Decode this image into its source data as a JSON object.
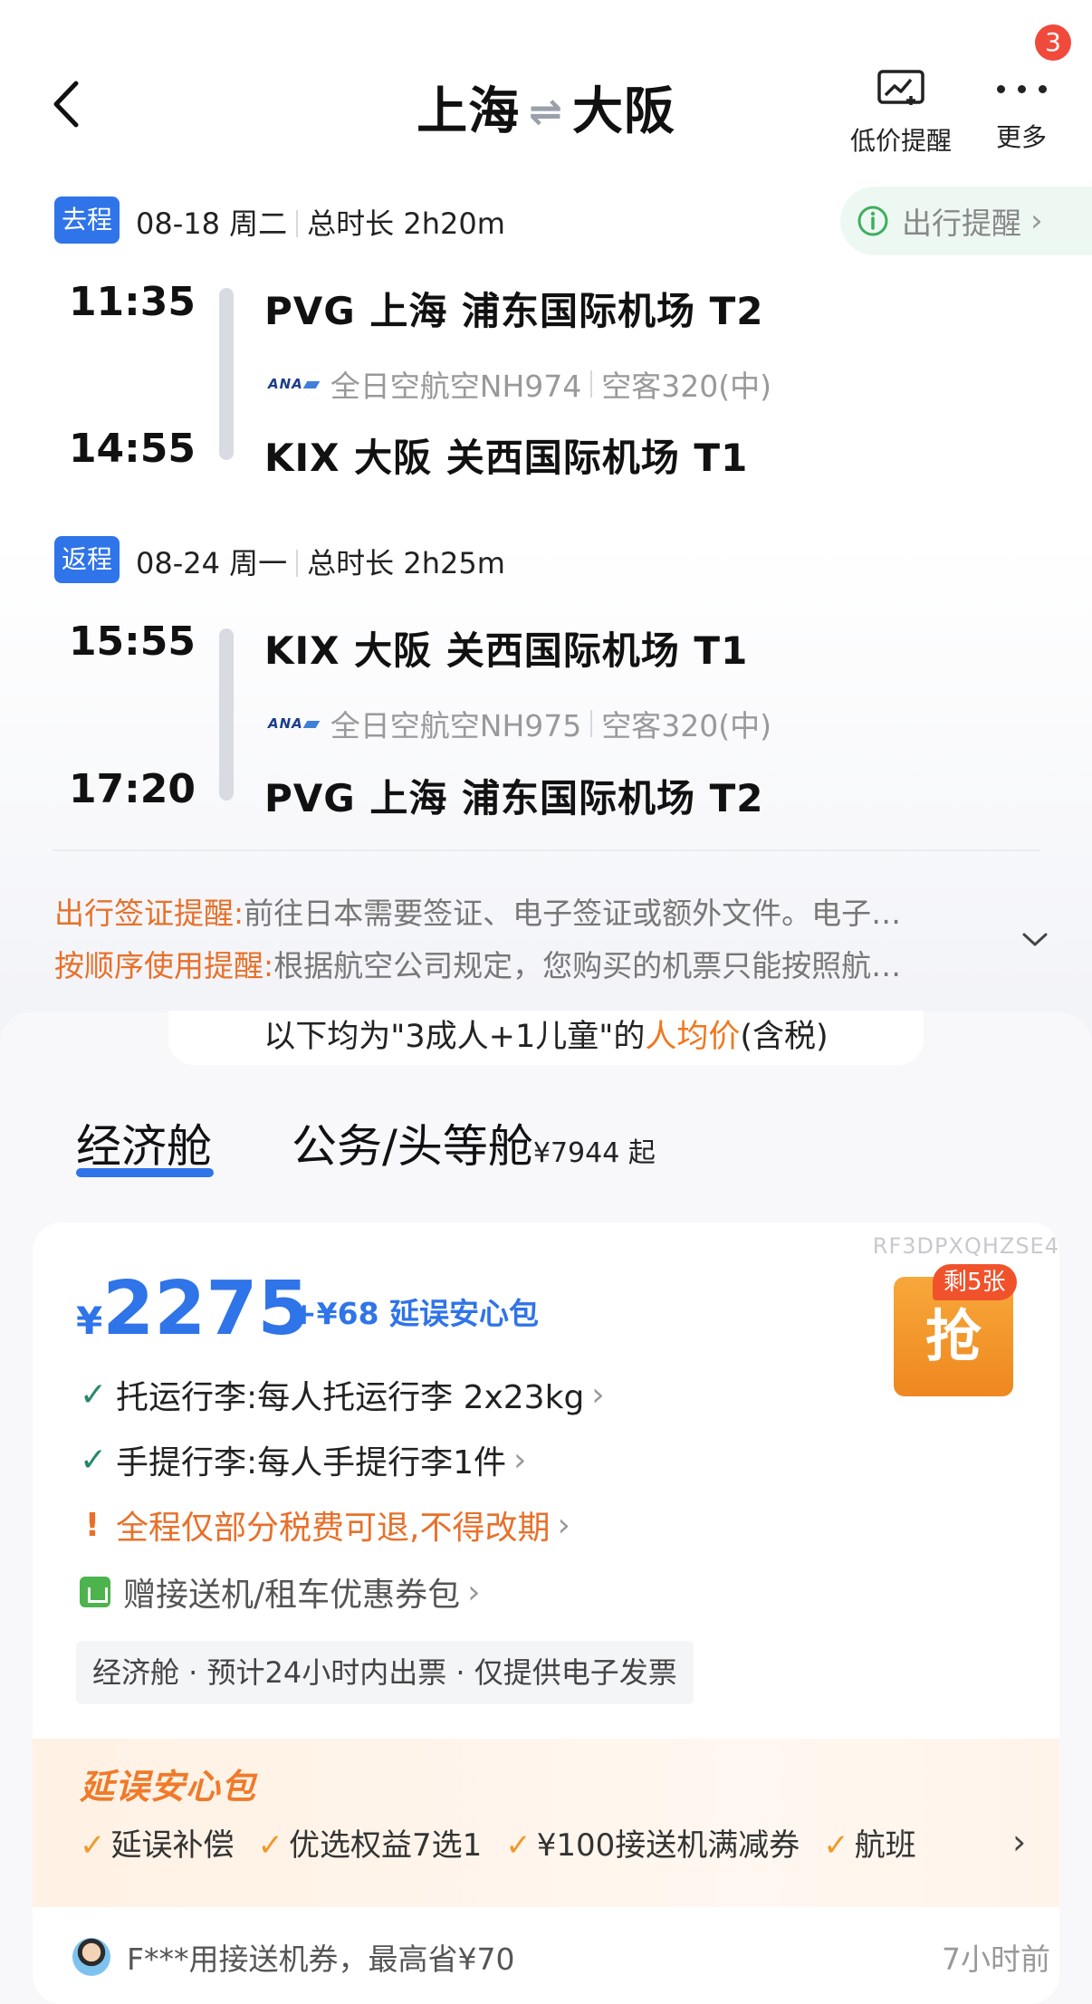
{
  "header": {
    "origin": "上海",
    "destination": "大阪",
    "alert_label": "低价提醒",
    "more_label": "更多",
    "badge_count": "3"
  },
  "outbound": {
    "tag": "去程",
    "date": "08-18 周二",
    "duration": "总时长 2h20m",
    "notice": "出行提醒",
    "dep_time": "11:35",
    "dep_airport": "PVG  上海 浦东国际机场 T2",
    "airline": "全日空航空NH974",
    "aircraft": "空客320(中)",
    "arr_time": "14:55",
    "arr_airport": "KIX  大阪 关西国际机场 T1"
  },
  "return": {
    "tag": "返程",
    "date": "08-24 周一",
    "duration": "总时长 2h25m",
    "dep_time": "15:55",
    "dep_airport": "KIX  大阪 关西国际机场 T1",
    "airline": "全日空航空NH975",
    "aircraft": "空客320(中)",
    "arr_time": "17:20",
    "arr_airport": "PVG  上海 浦东国际机场 T2"
  },
  "airline_logo_text": "ANA",
  "tips": [
    {
      "key": "出行签证提醒:",
      "text": "前往日本需要签证、电子签证或额外文件。电子…"
    },
    {
      "key": "按顺序使用提醒:",
      "text": "根据航空公司规定，您购买的机票只能按照航…"
    }
  ],
  "price_note": {
    "prefix": "以下均为\"3成人+1儿童\"的",
    "highlight": "人均价",
    "suffix": "(含税)"
  },
  "cabins": {
    "economy": "经济舱",
    "business": "公务/头等舱",
    "business_from": "¥7944 起"
  },
  "offer": {
    "code": "RF3DPXQHZSE4",
    "currency": "¥",
    "price": "2275",
    "addon": "+¥68 延误安心包",
    "remaining": "剩5张",
    "grab": "抢",
    "features": [
      "托运行李:每人托运行李 2x23kg",
      "手提行李:每人手提行李1件",
      "全程仅部分税费可退,不得改期",
      "赠接送机/租车优惠券包"
    ],
    "ticket_info": "经济舱 · 预计24小时内出票 · 仅提供电子发票"
  },
  "delay_package": {
    "title": "延误安心包",
    "items": [
      "延误补偿",
      "优选权益7选1",
      "¥100接送机满减券",
      "航班"
    ]
  },
  "activity": {
    "text": "F***用接送机券，最高省¥70",
    "time": "7小时前"
  },
  "colors": {
    "accent_blue": "#2f74e8",
    "accent_orange": "#e8702a",
    "badge_red": "#f04a3c"
  }
}
